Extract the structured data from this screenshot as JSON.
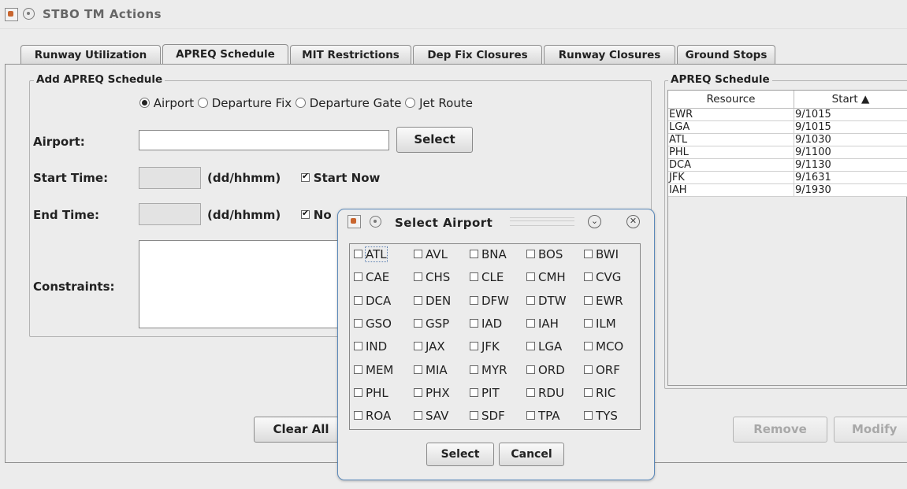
{
  "window": {
    "title": "STBO TM Actions",
    "icons": [
      "java-app-icon",
      "window-menu-icon"
    ]
  },
  "tabs": [
    {
      "label": "Runway Utilization",
      "active": false
    },
    {
      "label": "APREQ Schedule",
      "active": true
    },
    {
      "label": "MIT Restrictions",
      "active": false
    },
    {
      "label": "Dep Fix Closures",
      "active": false
    },
    {
      "label": "Runway Closures",
      "active": false
    },
    {
      "label": "Ground Stops",
      "active": false
    }
  ],
  "form": {
    "group_title": "Add APREQ Schedule",
    "radios": [
      {
        "label": "Airport",
        "selected": true
      },
      {
        "label": "Departure Fix",
        "selected": false
      },
      {
        "label": "Departure Gate",
        "selected": false
      },
      {
        "label": "Jet Route",
        "selected": false
      }
    ],
    "airport_label": "Airport:",
    "airport_value": "",
    "select_button": "Select",
    "start_label": "Start Time:",
    "start_format": "(dd/hhmm)",
    "start_now_label": "Start Now",
    "end_label": "End Time:",
    "end_format": "(dd/hhmm)",
    "end_now_label": "No",
    "constraints_label": "Constraints:",
    "clear_all_button": "Clear All"
  },
  "schedule": {
    "group_title": "APREQ Schedule",
    "columns": [
      "Resource",
      "Start ▲"
    ],
    "rows": [
      [
        "EWR",
        "9/1015"
      ],
      [
        "LGA",
        "9/1015"
      ],
      [
        "ATL",
        "9/1030"
      ],
      [
        "PHL",
        "9/1100"
      ],
      [
        "DCA",
        "9/1130"
      ],
      [
        "JFK",
        "9/1631"
      ],
      [
        "IAH",
        "9/1930"
      ]
    ],
    "remove_button": "Remove",
    "modify_button": "Modify"
  },
  "dialog": {
    "title": "Select Airport",
    "airports": [
      [
        "ATL",
        "AVL",
        "BNA",
        "BOS",
        "BWI"
      ],
      [
        "CAE",
        "CHS",
        "CLE",
        "CMH",
        "CVG"
      ],
      [
        "DCA",
        "DEN",
        "DFW",
        "DTW",
        "EWR"
      ],
      [
        "GSO",
        "GSP",
        "IAD",
        "IAH",
        "ILM"
      ],
      [
        "IND",
        "JAX",
        "JFK",
        "LGA",
        "MCO"
      ],
      [
        "MEM",
        "MIA",
        "MYR",
        "ORD",
        "ORF"
      ],
      [
        "PHL",
        "PHX",
        "PIT",
        "RDU",
        "RIC"
      ],
      [
        "ROA",
        "SAV",
        "SDF",
        "TPA",
        "TYS"
      ]
    ],
    "select_button": "Select",
    "cancel_button": "Cancel"
  }
}
